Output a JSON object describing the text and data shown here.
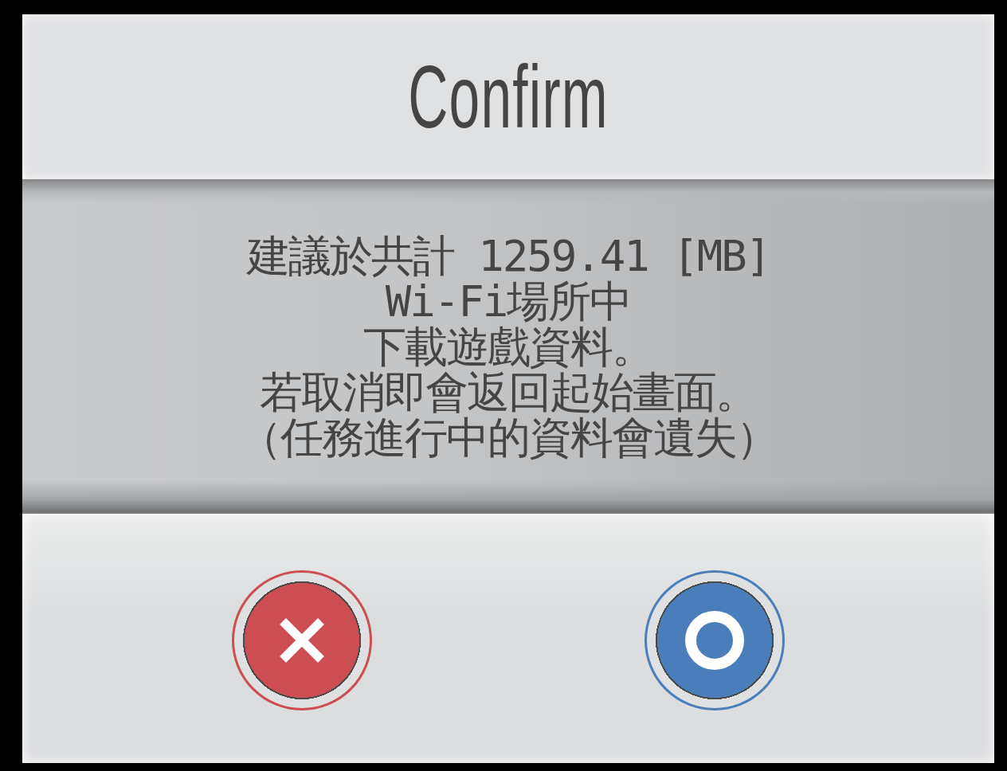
{
  "dialog": {
    "title": "Confirm",
    "message_lines": [
      "建議於共計 1259.41 [MB]",
      "Wi-Fi場所中",
      "下載遊戲資料。",
      "若取消即會返回起始畫面。",
      "（任務進行中的資料會遺失）"
    ],
    "buttons": [
      {
        "kind": "cancel",
        "color": "#cc4e52"
      },
      {
        "kind": "confirm",
        "color": "#4a7ebb"
      }
    ]
  }
}
